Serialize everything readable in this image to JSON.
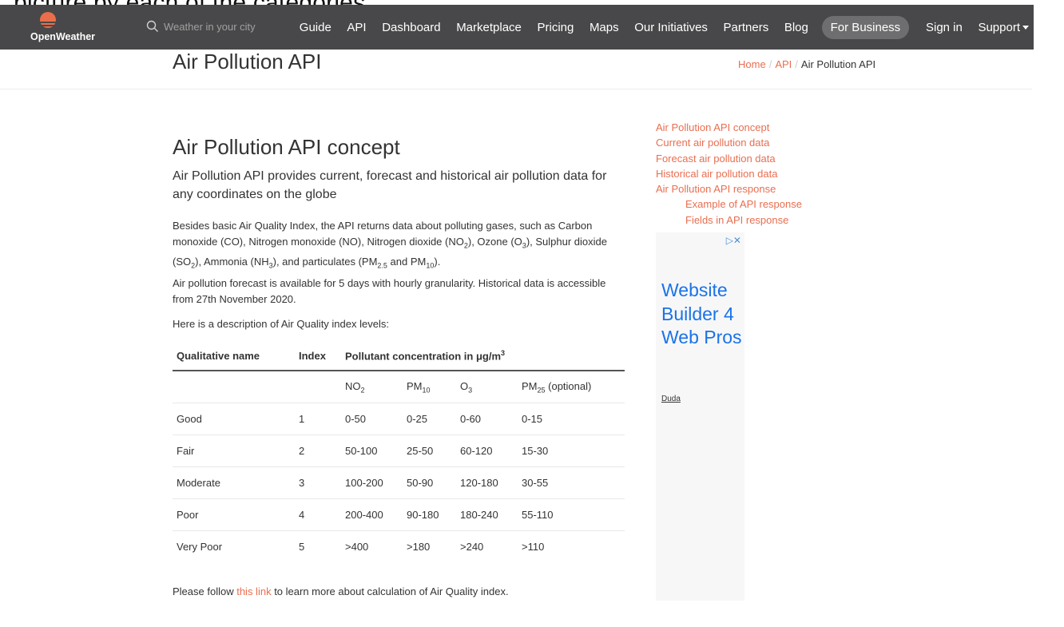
{
  "top_cut_text": ", picture by each of the categories,",
  "nav": {
    "logo_text": "OpenWeather",
    "search_placeholder": "Weather in your city",
    "items": [
      "Guide",
      "API",
      "Dashboard",
      "Marketplace",
      "Pricing",
      "Maps",
      "Our Initiatives",
      "Partners",
      "Blog"
    ],
    "business": "For Business",
    "signin": "Sign in",
    "support": "Support"
  },
  "header": {
    "title": "Air Pollution API",
    "breadcrumb": [
      "Home",
      "API",
      "Air Pollution API"
    ]
  },
  "main": {
    "heading": "Air Pollution API concept",
    "lead": "Air Pollution API provides current, forecast and historical air pollution data for any coordinates on the globe",
    "p1_a": "Besides basic Air Quality Index, the API returns data about polluting gases, such as Carbon monoxide (CO), Nitrogen monoxide (NO), Nitrogen dioxide (NO",
    "p2": "Air pollution forecast is available for 5 days with hourly granularity. Historical data is accessible from 27th November 2020.",
    "p3": "Here is a description of Air Quality index levels:",
    "p4_before": "Please follow ",
    "p4_link": "this link",
    "p4_after": " to learn more about calculation of Air Quality index."
  },
  "table": {
    "headers": [
      "Qualitative name",
      "Index",
      "Pollutant concentration in μg/m"
    ],
    "sub_headers": [
      "NO",
      "PM",
      "O",
      "PM",
      "(optional)"
    ],
    "rows": [
      [
        "Good",
        "1",
        "0-50",
        "0-25",
        "0-60",
        "0-15"
      ],
      [
        "Fair",
        "2",
        "50-100",
        "25-50",
        "60-120",
        "15-30"
      ],
      [
        "Moderate",
        "3",
        "100-200",
        "50-90",
        "120-180",
        "30-55"
      ],
      [
        "Poor",
        "4",
        "200-400",
        "90-180",
        "180-240",
        "55-110"
      ],
      [
        "Very Poor",
        "5",
        ">400",
        ">180",
        ">240",
        ">110"
      ]
    ]
  },
  "toc": [
    "Air Pollution API concept",
    "Current air pollution data",
    "Forecast air pollution data",
    "Historical air pollution data",
    "Air Pollution API response",
    "Example of API response",
    "Fields in API response"
  ],
  "ad": {
    "headline": "Website Builder 4 Web Pros",
    "brand": "Duda",
    "close": "▷✕"
  },
  "colors": {
    "nav_bg": "#48484a",
    "accent": "#e96e50",
    "ad_blue": "#1a73e8"
  }
}
